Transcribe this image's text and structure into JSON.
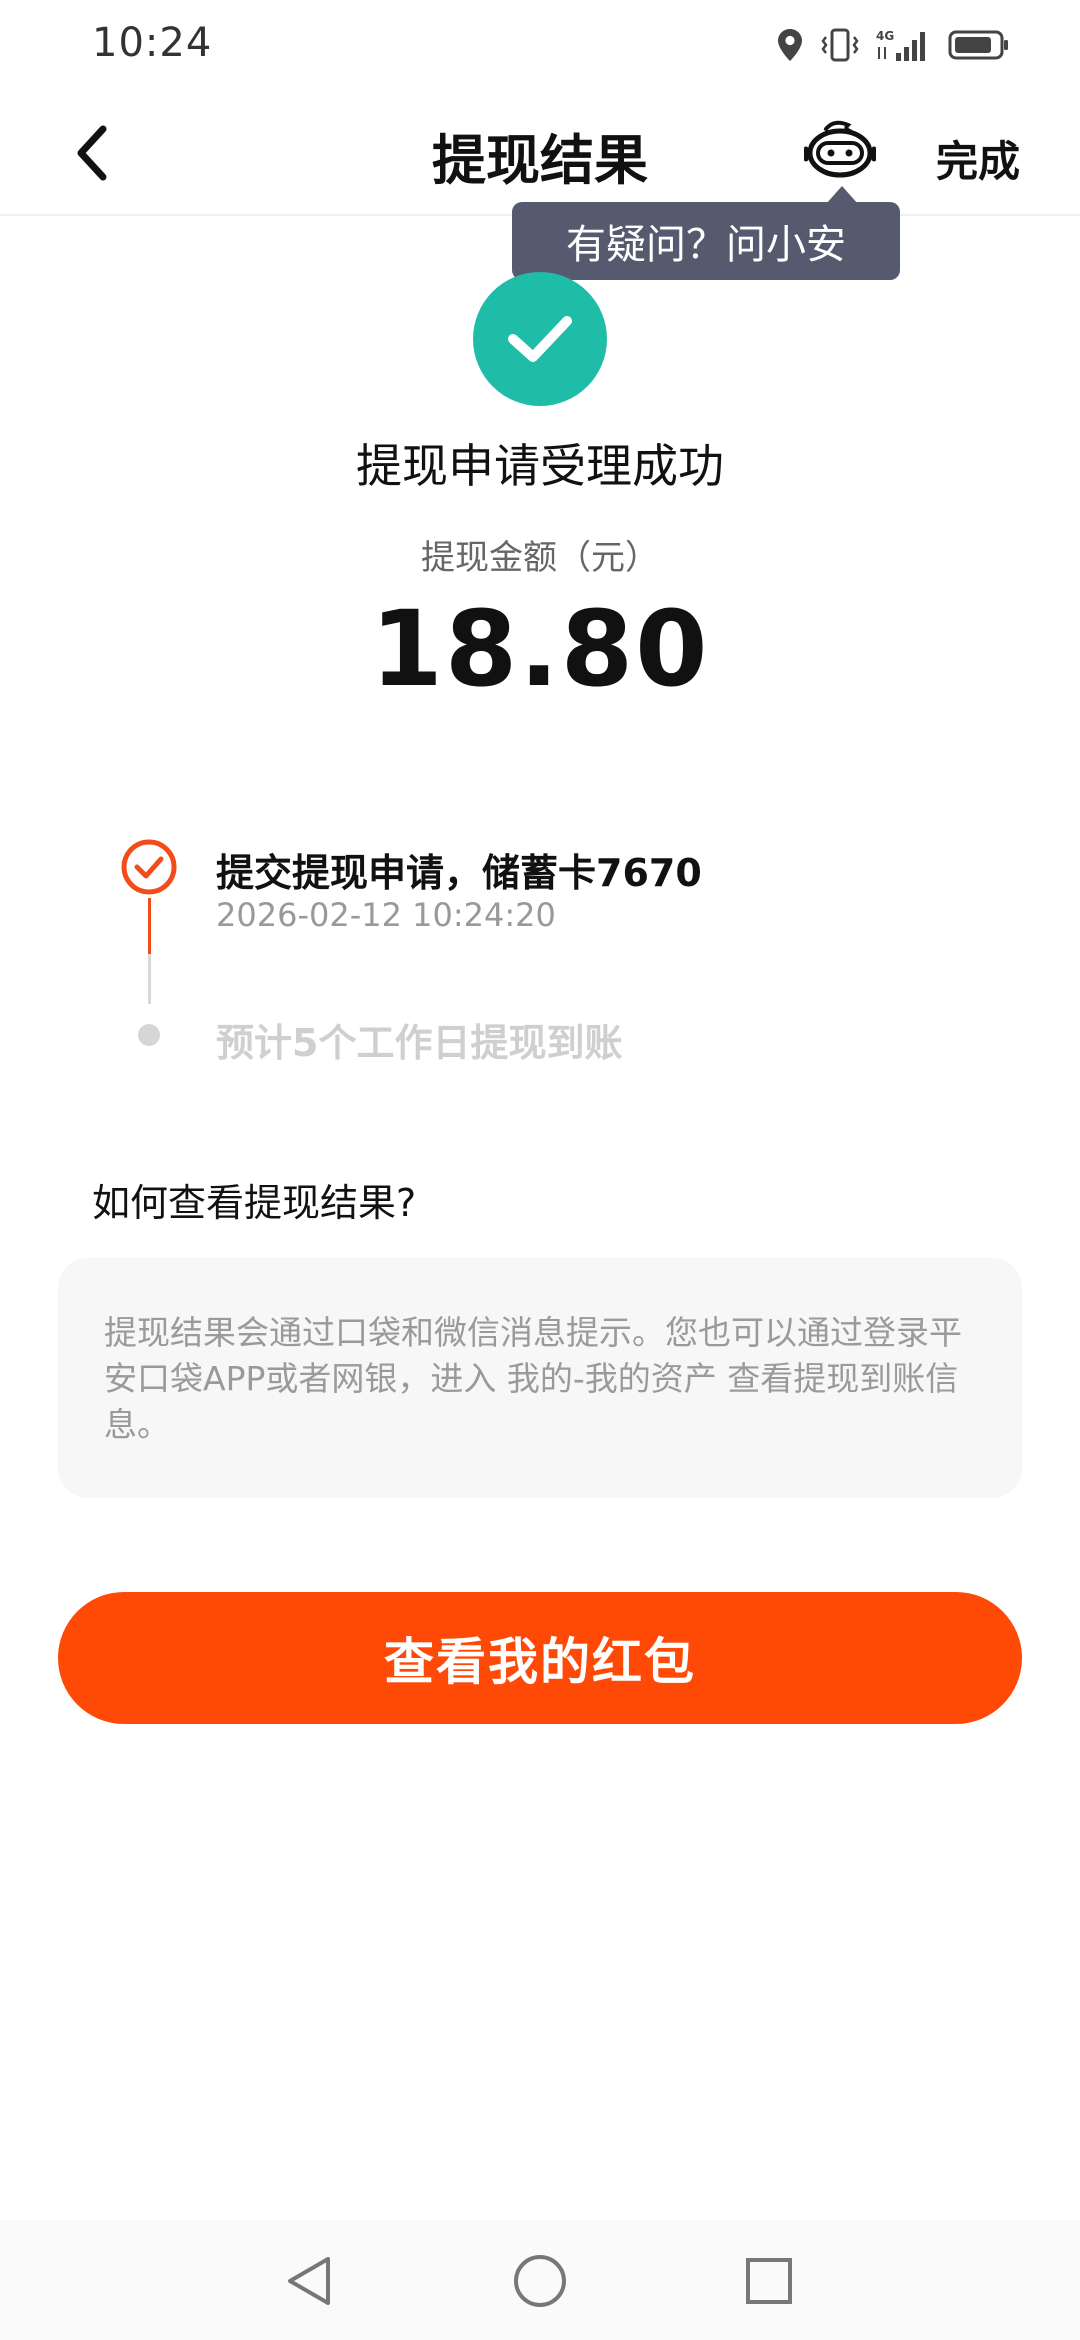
{
  "status_bar": {
    "time": "10:24",
    "network_label": "4G",
    "icons": [
      "location-icon",
      "vibrate-icon",
      "signal-icon",
      "battery-icon"
    ]
  },
  "header": {
    "title": "提现结果",
    "done_label": "完成",
    "back_icon": "chevron-left-icon",
    "assistant_icon": "assistant-robot-icon"
  },
  "tooltip": {
    "text": "有疑问？问小安"
  },
  "result": {
    "status_title": "提现申请受理成功",
    "amount_label": "提现金额（元）",
    "amount": "18.80"
  },
  "timeline": {
    "steps": [
      {
        "title": "提交提现申请，储蓄卡7670",
        "time": "2026-02-12 10:24:20",
        "state": "done"
      },
      {
        "title": "预计5个工作日提现到账",
        "state": "pending"
      }
    ]
  },
  "faq": {
    "title": "如何查看提现结果?",
    "body": "提现结果会通过口袋和微信消息提示。您也可以通过登录平安口袋APP或者网银，进入 我的-我的资产 查看提现到账信息。"
  },
  "action": {
    "button_label": "查看我的红包"
  },
  "colors": {
    "accent": "#ff4a07",
    "success": "#1fbca8",
    "timeline_active": "#f24c1a",
    "tooltip_bg": "#555a6e"
  }
}
